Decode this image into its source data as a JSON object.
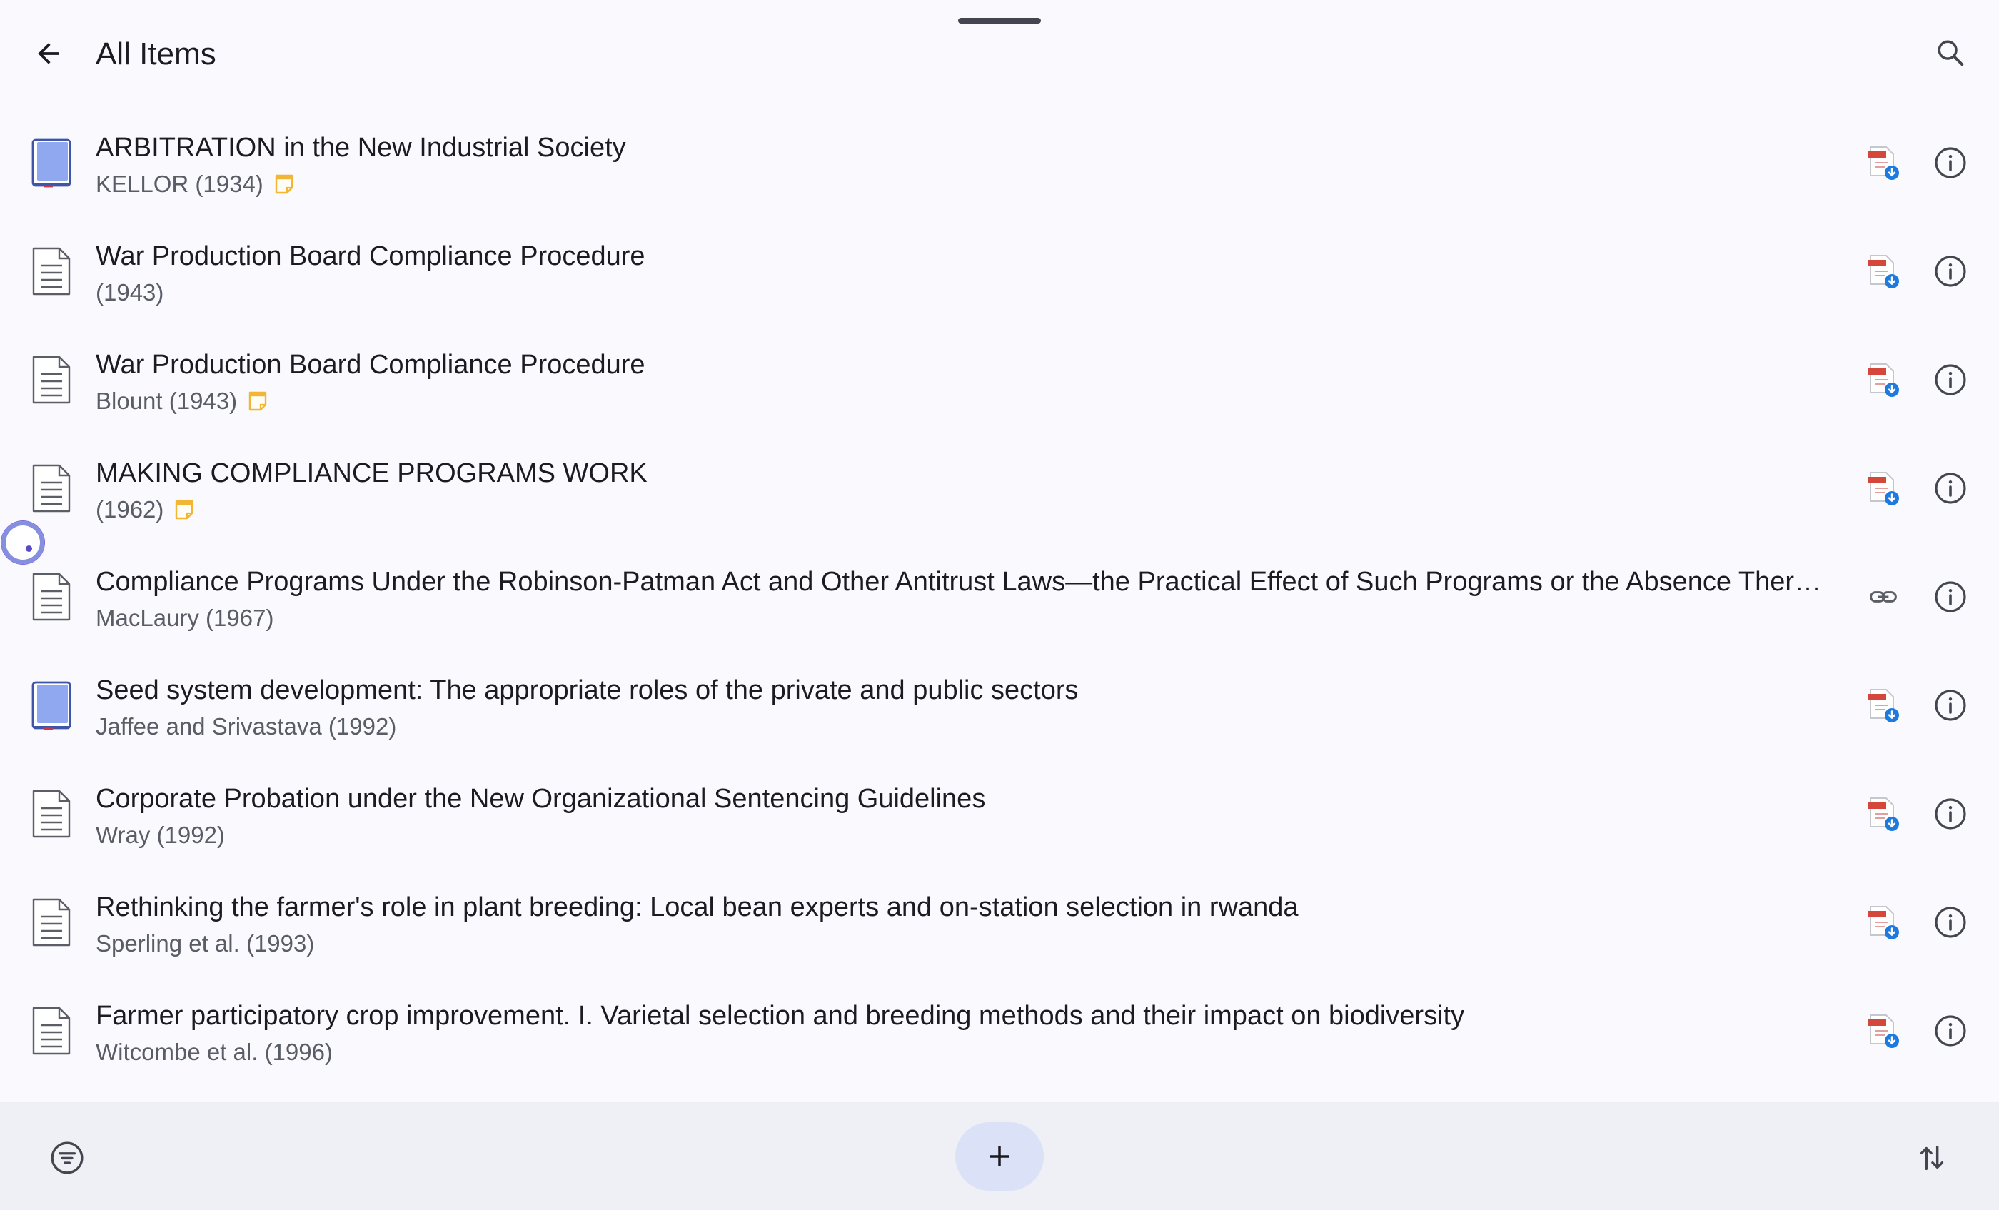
{
  "header": {
    "title": "All Items",
    "back_icon": "arrow-back-icon",
    "search_icon": "search-icon"
  },
  "items": [
    {
      "type": "book",
      "title": "ARBITRATION in the New Industrial Society",
      "subtitle": "KELLOR (1934)",
      "has_note": true,
      "attachment": "pdf"
    },
    {
      "type": "document",
      "title": "War Production Board Compliance Procedure",
      "subtitle": "(1943)",
      "has_note": false,
      "attachment": "pdf"
    },
    {
      "type": "document",
      "title": "War Production Board Compliance Procedure",
      "subtitle": "Blount (1943)",
      "has_note": true,
      "attachment": "pdf"
    },
    {
      "type": "document",
      "title": "MAKING COMPLIANCE PROGRAMS WORK",
      "subtitle": "(1962)",
      "has_note": true,
      "attachment": "pdf"
    },
    {
      "type": "document",
      "title": "Compliance Programs Under the Robinson-Patman Act and Other Antitrust Laws—the Practical Effect of Such Programs or the Absence Ther…",
      "subtitle": "MacLaury (1967)",
      "has_note": false,
      "attachment": "link"
    },
    {
      "type": "book",
      "title": "Seed system development: The appropriate roles of the private and public sectors",
      "subtitle": "Jaffee and Srivastava (1992)",
      "has_note": false,
      "attachment": "pdf"
    },
    {
      "type": "document",
      "title": "Corporate Probation under the New Organizational Sentencing Guidelines",
      "subtitle": "Wray (1992)",
      "has_note": false,
      "attachment": "pdf"
    },
    {
      "type": "document",
      "title": "Rethinking the farmer's role in plant breeding: Local bean experts and on-station selection in rwanda",
      "subtitle": "Sperling et al. (1993)",
      "has_note": false,
      "attachment": "pdf"
    },
    {
      "type": "document",
      "title": "Farmer participatory crop improvement. I. Varietal selection and breeding methods and their impact on biodiversity",
      "subtitle": "Witcombe et al. (1996)",
      "has_note": false,
      "attachment": "pdf"
    }
  ],
  "bottom_bar": {
    "filter_icon": "filter-icon",
    "add_icon": "plus-icon",
    "sort_icon": "sort-icon"
  },
  "colors": {
    "background": "#f9f9fe",
    "bottom_bar": "#eef0f6",
    "add_button": "#dbe1f7",
    "book_icon": "#8fa8ef",
    "pdf_red": "#d5473b",
    "download_blue": "#1f7ae0",
    "note_yellow": "#f2b634"
  }
}
